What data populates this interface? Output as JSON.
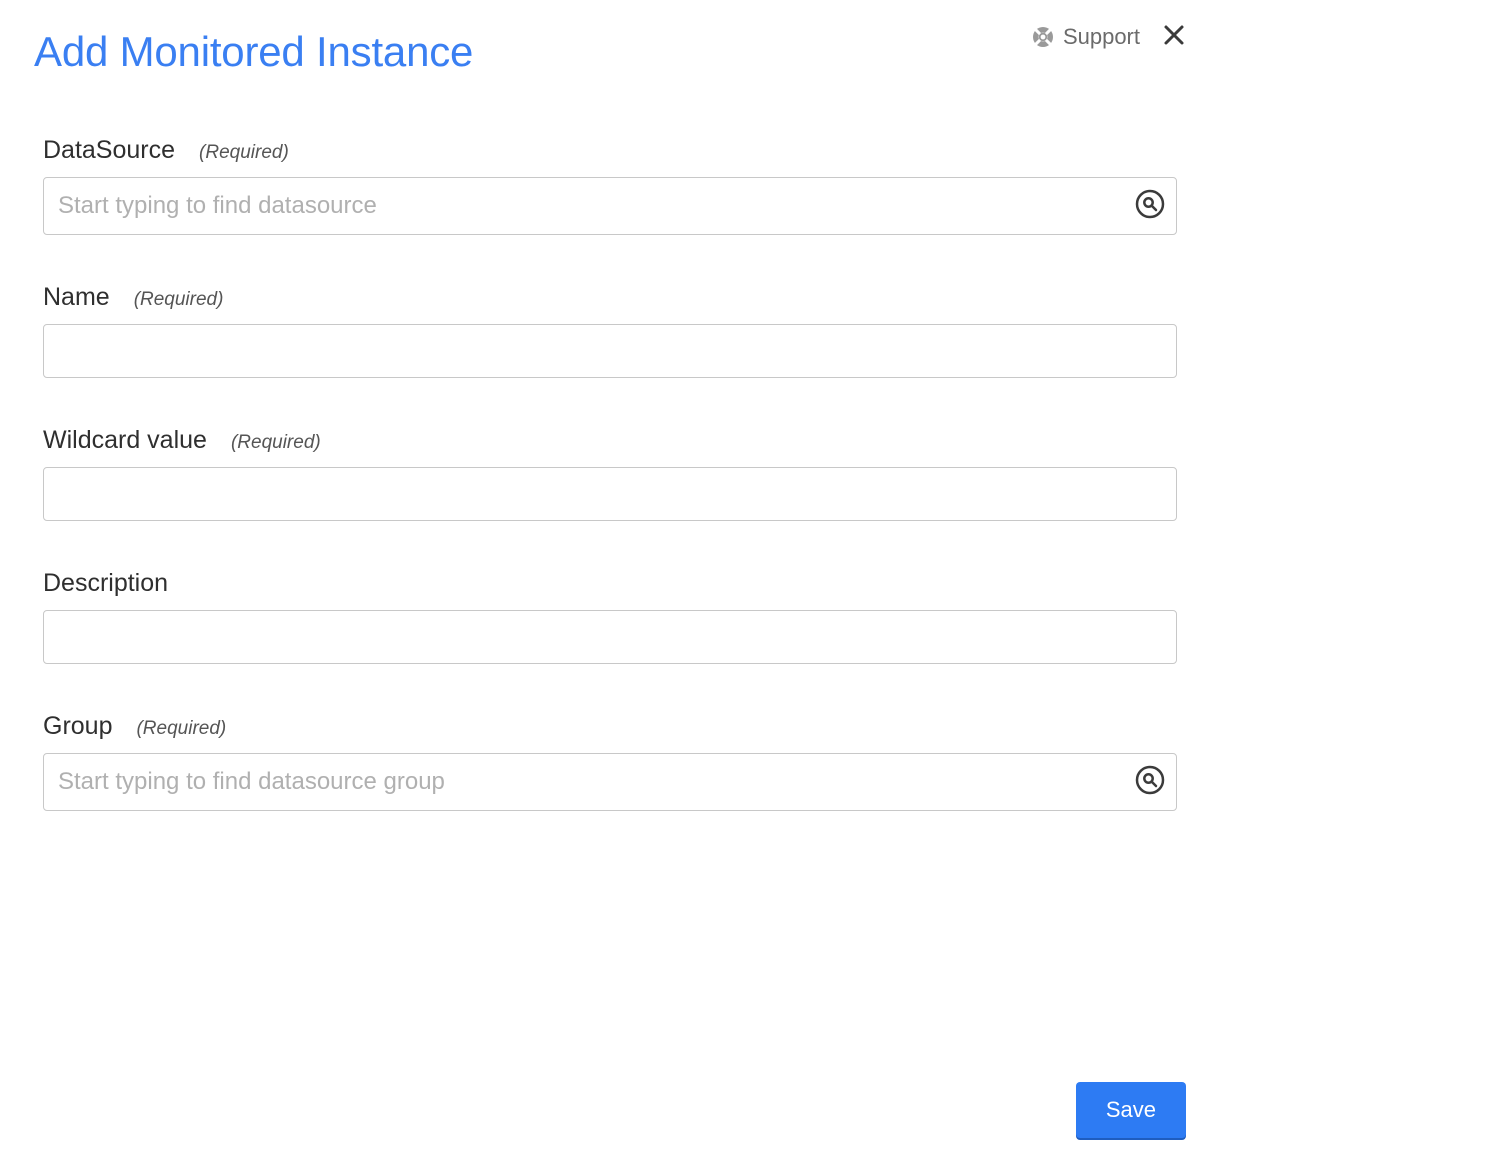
{
  "header": {
    "title": "Add Monitored Instance",
    "support_label": "Support"
  },
  "form": {
    "datasource": {
      "label": "DataSource",
      "required_hint": "(Required)",
      "placeholder": "Start typing to find datasource",
      "value": ""
    },
    "name": {
      "label": "Name",
      "required_hint": "(Required)",
      "value": ""
    },
    "wildcard": {
      "label": "Wildcard value",
      "required_hint": "(Required)",
      "value": ""
    },
    "description": {
      "label": "Description",
      "value": ""
    },
    "group": {
      "label": "Group",
      "required_hint": "(Required)",
      "placeholder": "Start typing to find datasource group",
      "value": ""
    }
  },
  "footer": {
    "save_label": "Save"
  }
}
